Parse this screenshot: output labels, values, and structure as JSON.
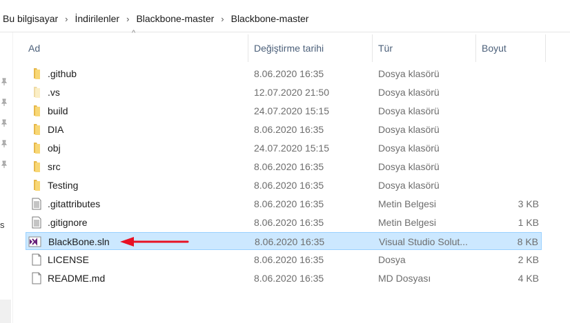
{
  "breadcrumb": {
    "items": [
      "Bu bilgisayar",
      "İndirilenler",
      "Blackbone-master",
      "Blackbone-master"
    ],
    "separator": "›"
  },
  "columns": {
    "name": "Ad",
    "date": "Değiştirme tarihi",
    "type": "Tür",
    "size": "Boyut",
    "sort_indicator": "^"
  },
  "nav_letter": "s",
  "files": [
    {
      "name": ".github",
      "date": "8.06.2020 16:35",
      "type": "Dosya klasörü",
      "size": "",
      "icon": "folder-icon"
    },
    {
      "name": ".vs",
      "date": "12.07.2020 21:50",
      "type": "Dosya klasörü",
      "size": "",
      "icon": "folder-hidden-icon"
    },
    {
      "name": "build",
      "date": "24.07.2020 15:15",
      "type": "Dosya klasörü",
      "size": "",
      "icon": "folder-icon"
    },
    {
      "name": "DIA",
      "date": "8.06.2020 16:35",
      "type": "Dosya klasörü",
      "size": "",
      "icon": "folder-icon"
    },
    {
      "name": "obj",
      "date": "24.07.2020 15:15",
      "type": "Dosya klasörü",
      "size": "",
      "icon": "folder-icon"
    },
    {
      "name": "src",
      "date": "8.06.2020 16:35",
      "type": "Dosya klasörü",
      "size": "",
      "icon": "folder-icon"
    },
    {
      "name": "Testing",
      "date": "8.06.2020 16:35",
      "type": "Dosya klasörü",
      "size": "",
      "icon": "folder-icon"
    },
    {
      "name": ".gitattributes",
      "date": "8.06.2020 16:35",
      "type": "Metin Belgesi",
      "size": "3 KB",
      "icon": "text-file-icon"
    },
    {
      "name": ".gitignore",
      "date": "8.06.2020 16:35",
      "type": "Metin Belgesi",
      "size": "1 KB",
      "icon": "text-file-icon"
    },
    {
      "name": "BlackBone.sln",
      "date": "8.06.2020 16:35",
      "type": "Visual Studio Solut...",
      "size": "8 KB",
      "icon": "visual-studio-solution-icon",
      "selected": true
    },
    {
      "name": "LICENSE",
      "date": "8.06.2020 16:35",
      "type": "Dosya",
      "size": "2 KB",
      "icon": "blank-file-icon"
    },
    {
      "name": "README.md",
      "date": "8.06.2020 16:35",
      "type": "MD Dosyası",
      "size": "4 KB",
      "icon": "blank-file-icon"
    }
  ],
  "colors": {
    "selection": "#cce8ff",
    "selection_border": "#99d1ff",
    "folder": "#f8d775",
    "annotation_arrow": "#e81123",
    "header_text": "#4c607a"
  }
}
